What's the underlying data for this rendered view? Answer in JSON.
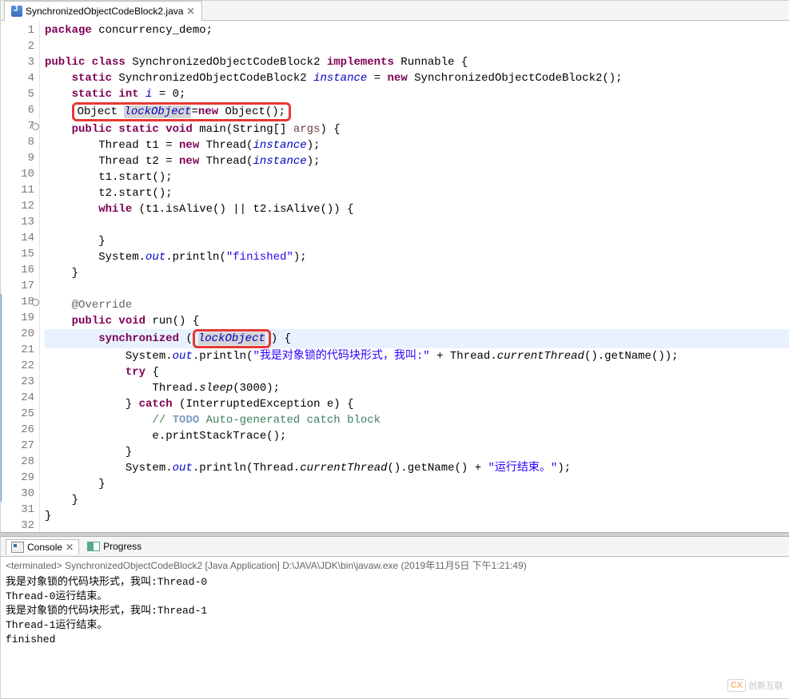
{
  "tab": {
    "filename": "SynchronizedObjectCodeBlock2.java"
  },
  "code": {
    "lines": [
      {
        "n": 1,
        "html": "<span class='kw'>package</span> concurrency_demo;"
      },
      {
        "n": 2,
        "html": ""
      },
      {
        "n": 3,
        "html": "<span class='kw'>public class</span> SynchronizedObjectCodeBlock2 <span class='kw'>implements</span> Runnable {"
      },
      {
        "n": 4,
        "html": "    <span class='kw'>static</span> SynchronizedObjectCodeBlock2 <span class='field'>instance</span> = <span class='kw'>new</span> SynchronizedObjectCodeBlock2();"
      },
      {
        "n": 5,
        "html": "    <span class='kw'>static int</span> <span class='field'>i</span> = 0;"
      },
      {
        "n": 6,
        "html": "    <span class='red-box'>Object <span class='hl-word field'>lockObject</span>=<span class='kw'>new</span> Object();</span>"
      },
      {
        "n": 7,
        "ovr": true,
        "html": "    <span class='kw'>public static void</span> main(String[] <span class='param'>args</span>) {"
      },
      {
        "n": 8,
        "html": "        Thread t1 = <span class='kw'>new</span> Thread(<span class='field'>instance</span>);"
      },
      {
        "n": 9,
        "html": "        Thread t2 = <span class='kw'>new</span> Thread(<span class='field'>instance</span>);"
      },
      {
        "n": 10,
        "html": "        t1.start();"
      },
      {
        "n": 11,
        "html": "        t2.start();"
      },
      {
        "n": 12,
        "html": "        <span class='kw'>while</span> (t1.isAlive() || t2.isAlive()) {"
      },
      {
        "n": 13,
        "html": ""
      },
      {
        "n": 14,
        "html": "        }"
      },
      {
        "n": 15,
        "html": "        System.<span class='field'>out</span>.println(<span class='str'>\"finished\"</span>);"
      },
      {
        "n": 16,
        "html": "    }"
      },
      {
        "n": 17,
        "html": ""
      },
      {
        "n": 18,
        "ovr": true,
        "mark": true,
        "html": "    <span class='ann'>@Override</span>"
      },
      {
        "n": 19,
        "mark": true,
        "html": "    <span class='kw'>public void</span> run() {"
      },
      {
        "n": 20,
        "mark": true,
        "cur": true,
        "html": "        <span class='kw'>synchronized</span> (<span class='red-box'><span class='hl-word field'>lockObject</span></span>) {"
      },
      {
        "n": 21,
        "mark": true,
        "html": "            System.<span class='field'>out</span>.println(<span class='str'>\"我是对象锁的代码块形式，我叫:\"</span> + Thread.<span style='font-style:italic'>currentThread</span>().getName());"
      },
      {
        "n": 22,
        "mark": true,
        "html": "            <span class='kw'>try</span> {"
      },
      {
        "n": 23,
        "mark": true,
        "html": "                Thread.<span style='font-style:italic'>sleep</span>(3000);"
      },
      {
        "n": 24,
        "mark": true,
        "html": "            } <span class='kw'>catch</span> (InterruptedException e) {"
      },
      {
        "n": 25,
        "mark": true,
        "html": "                <span class='cmt'>// </span><span class='todo'>TODO</span><span class='cmt'> Auto-generated catch block</span>"
      },
      {
        "n": 26,
        "mark": true,
        "html": "                e.printStackTrace();"
      },
      {
        "n": 27,
        "mark": true,
        "html": "            }"
      },
      {
        "n": 28,
        "mark": true,
        "html": "            System.<span class='field'>out</span>.println(Thread.<span style='font-style:italic'>currentThread</span>().getName() + <span class='str'>\"运行结束。\"</span>);"
      },
      {
        "n": 29,
        "mark": true,
        "html": "        }"
      },
      {
        "n": 30,
        "mark": true,
        "html": "    }"
      },
      {
        "n": 31,
        "html": "}"
      },
      {
        "n": 32,
        "html": ""
      }
    ]
  },
  "console": {
    "tab_console": "Console",
    "tab_progress": "Progress",
    "header_prefix": "<terminated>",
    "header": "SynchronizedObjectCodeBlock2 [Java Application] D:\\JAVA\\JDK\\bin\\javaw.exe (2019年11月5日 下午1:21:49)",
    "output": [
      "我是对象锁的代码块形式，我叫:Thread-0",
      "Thread-0运行结束。",
      "我是对象锁的代码块形式，我叫:Thread-1",
      "Thread-1运行结束。",
      "finished"
    ]
  },
  "watermark": {
    "brand": "CX",
    "text": "创新互联"
  }
}
